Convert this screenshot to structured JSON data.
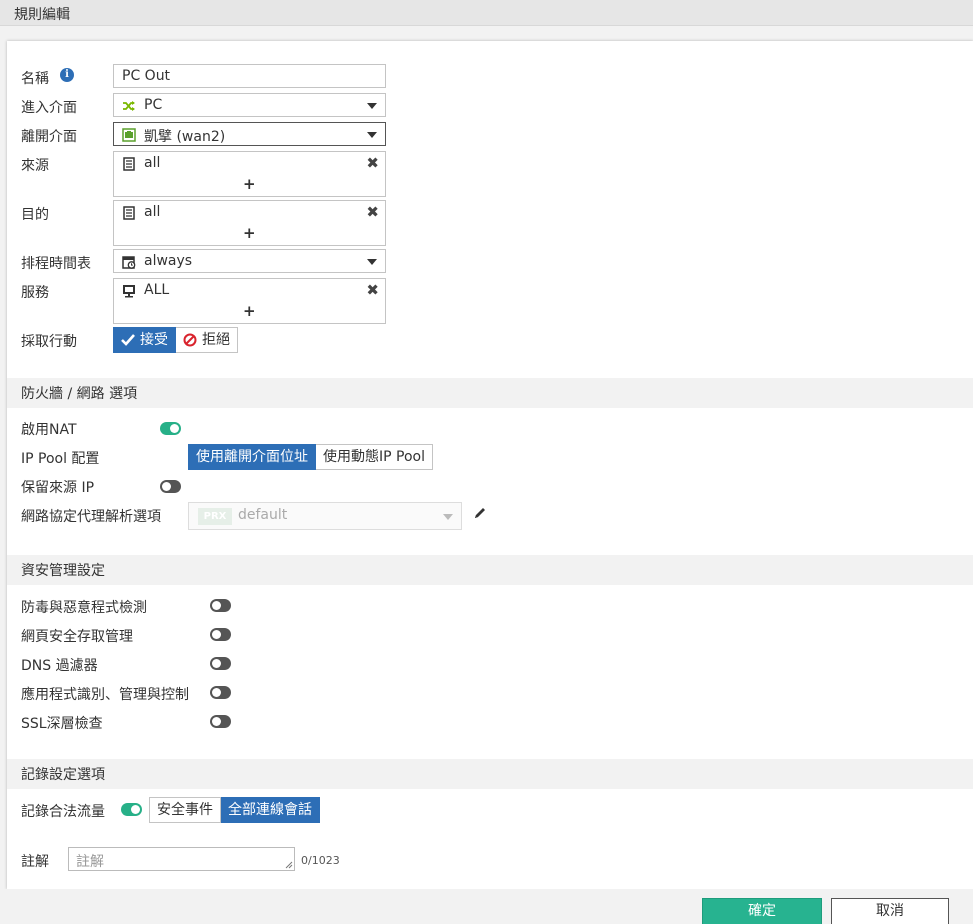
{
  "window": {
    "title": "規則編輯"
  },
  "form": {
    "name_label": "名稱",
    "name_value": "PC Out",
    "incoming_label": "進入介面",
    "incoming_value": "PC",
    "outgoing_label": "離開介面",
    "outgoing_value": "凱擘 (wan2)",
    "source_label": "來源",
    "source_value": "all",
    "destination_label": "目的",
    "destination_value": "all",
    "schedule_label": "排程時間表",
    "schedule_value": "always",
    "service_label": "服務",
    "service_value": "ALL",
    "add_symbol": "+",
    "remove_symbol": "✖",
    "action_label": "採取行動",
    "action_options": [
      "接受",
      "拒絕"
    ],
    "action_selected": "接受"
  },
  "firewall": {
    "section_title": "防火牆 / 網路 選項",
    "nat_label": "啟用NAT",
    "nat_enabled": true,
    "ippool_label": "IP Pool 配置",
    "ippool_options": [
      "使用離開介面位址",
      "使用動態IP Pool"
    ],
    "ippool_selected": "使用離開介面位址",
    "preserve_label": "保留來源 IP",
    "preserve_enabled": false,
    "proxy_label": "網路協定代理解析選項",
    "proxy_badge": "PRX",
    "proxy_value": "default"
  },
  "security": {
    "section_title": "資安管理設定",
    "items": [
      {
        "label": "防毒與惡意程式檢測",
        "enabled": false
      },
      {
        "label": "網頁安全存取管理",
        "enabled": false
      },
      {
        "label": "DNS 過濾器",
        "enabled": false
      },
      {
        "label": "應用程式識別、管理與控制",
        "enabled": false
      },
      {
        "label": "SSL深層檢查",
        "enabled": false
      }
    ]
  },
  "logging": {
    "section_title": "記錄設定選項",
    "traffic_label": "記錄合法流量",
    "traffic_enabled": true,
    "traffic_options": [
      "安全事件",
      "全部連線會話"
    ],
    "traffic_selected": "全部連線會話",
    "comment_label": "註解",
    "comment_placeholder": "註解",
    "comment_counter": "0/1023"
  },
  "footer": {
    "ok_label": "確定",
    "cancel_label": "取消"
  },
  "colors": {
    "accent": "#2d6eb6",
    "toggle_on": "#27b088",
    "ok_button": "#27b390"
  }
}
